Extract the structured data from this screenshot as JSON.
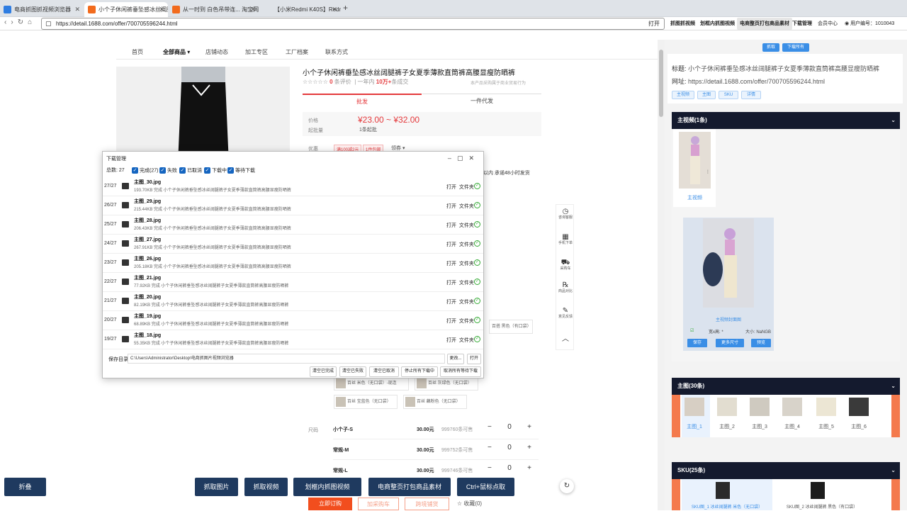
{
  "tabs": [
    {
      "label": "电商抓图抓视频浏览器",
      "color": "#2f7de1"
    },
    {
      "label": "小个子休闲裤垂坠感冰丝阔腿裤子",
      "color": "#f26b1d"
    },
    {
      "label": "从一时到 白色吊带连... 淘宝网",
      "color": "#f26b1d"
    },
    {
      "label": "【小米Redmi K40S】Redmi K40:",
      "color": "#e22"
    }
  ],
  "newtab": "+",
  "address": {
    "url": "https://detail.1688.com/offer/700705596244.html",
    "open": "打开"
  },
  "topbuttons": [
    "抓图抓视频",
    "划框内抓图视频",
    "电商整页打包商品素材",
    "下载管理",
    "会员中心",
    "用户编号：1010043"
  ],
  "nav": [
    "首页",
    "全部商品 ▾",
    "店铺动态",
    "加工专区",
    "工厂档案",
    "联系方式"
  ],
  "product": {
    "title": "小个子休闲裤垂坠感冰丝阔腿裤子女夏季薄款直筒裤高腰显瘦防晒裤",
    "reviews_count": "0",
    "reviews_label": "条评价",
    "sold_prefix": "一年内",
    "sold": "10万+",
    "sold_suffix": "条成交",
    "report": "本产品采购属于商业贸易行为",
    "tab_wholesale": "批发",
    "tab_dropship": "一件代发",
    "price_label": "价格",
    "price": "¥23.00 ~ ¥32.00",
    "minbuy_label": "起批量",
    "minbuy": "1条起批",
    "promo_label": "优惠",
    "promo1": "满100减2元",
    "promo2": "1件包邮",
    "promo_more": "领券 ▾",
    "delivery_note": "以内 承诺48小时发货",
    "size_label": "尺码",
    "swatches": [
      "百搭 黑色（有口袋）",
      "百丝 米色（无口袋）-现连",
      "百丝 灰绿色（无口袋）",
      "百丝 宝蓝色（无口袋）",
      "百丝 藕粉色（无口袋）"
    ],
    "sizes": [
      {
        "name": "小个子-S",
        "price": "30.00元",
        "stock": "999760条可售",
        "qty": "0"
      },
      {
        "name": "常规-M",
        "price": "30.00元",
        "stock": "999752条可售",
        "qty": "0"
      },
      {
        "name": "常规-L",
        "price": "30.00元",
        "stock": "999746条可售",
        "qty": "0"
      }
    ]
  },
  "sidefloat": [
    {
      "icon": "◷",
      "label": "咨询客服"
    },
    {
      "icon": "▦",
      "label": "手机下单"
    },
    {
      "icon": "⛟",
      "label": "采购车"
    },
    {
      "icon": "℞",
      "label": "商品对比"
    },
    {
      "icon": "✎",
      "label": "意见反馈"
    },
    {
      "icon": "︿",
      "label": ""
    }
  ],
  "bottom": [
    "折叠",
    "抓取图片",
    "抓取视频",
    "划框内抓图视频",
    "电商整页打包商品素材",
    "Ctrl+鼠标点取"
  ],
  "buy": {
    "order": "立即订购",
    "cart": "加采购车",
    "cross": "跨境铺货",
    "fav": "☆ 收藏(0)"
  },
  "dialog": {
    "title": "下载管理",
    "total_label": "总数:",
    "total": "27",
    "filters": [
      "完成(27)",
      "失败",
      "已取消",
      "下载中",
      "等待下载"
    ],
    "rows": [
      {
        "idx": "27/27",
        "name": "主图_30.jpg",
        "size": "193.70KB",
        "status": "完成"
      },
      {
        "idx": "26/27",
        "name": "主图_29.jpg",
        "size": "215.44KB",
        "status": "完成"
      },
      {
        "idx": "25/27",
        "name": "主图_28.jpg",
        "size": "206.43KB",
        "status": "完成"
      },
      {
        "idx": "24/27",
        "name": "主图_27.jpg",
        "size": "267.91KB",
        "status": "完成"
      },
      {
        "idx": "23/27",
        "name": "主图_26.jpg",
        "size": "205.18KB",
        "status": "完成"
      },
      {
        "idx": "22/27",
        "name": "主图_21.jpg",
        "size": "77.92KB",
        "status": "完成"
      },
      {
        "idx": "21/27",
        "name": "主图_20.jpg",
        "size": "82.19KB",
        "status": "完成"
      },
      {
        "idx": "20/27",
        "name": "主图_19.jpg",
        "size": "68.89KB",
        "status": "完成"
      },
      {
        "idx": "19/27",
        "name": "主图_18.jpg",
        "size": "55.35KB",
        "status": "完成"
      }
    ],
    "row_desc": "小个子休闲裤垂坠感冰丝阔腿裤子女夏季薄款直筒裤高腰显瘦防晒裤",
    "open": "打开",
    "folder": "文件夹",
    "save_label": "保存目录",
    "save_path": "C:\\Users\\Administrator\\Desktop\\电商抓图片视频浏览器",
    "change": "更改...",
    "open_btn": "打开",
    "actions": [
      "清空已完成",
      "清空已失败",
      "清空已取消",
      "停止所有下载中",
      "取消所有等待下载"
    ]
  },
  "right": {
    "grab": "抓取",
    "download_all": "下载所有",
    "title_label": "标题:",
    "title": "小个子休闲裤垂坠感冰丝阔腿裤子女夏季薄款直筒裤高腰显瘦防晒裤",
    "url_label": "网址:",
    "url": "https://detail.1688.com/offer/700705596244.html",
    "chips": [
      "主视频",
      "主图",
      "SKU",
      "详情"
    ],
    "video_head": "主视频(1条)",
    "video_caption": "主视频",
    "cover_caption": "主视频封面图",
    "cover_size": "宽x高: *",
    "cover_bytes": "大小: NaNGB",
    "cover_buttons": [
      "保存",
      "更多尺寸",
      "预览"
    ],
    "main_head": "主图(30条)",
    "main_items": [
      "主图_1",
      "主图_2",
      "主图_3",
      "主图_4",
      "主图_5",
      "主图_6"
    ],
    "sku_head": "SKU(25条)",
    "sku_items": [
      "SKU图_1 冰丝阔腿裤 米色（无口袋）",
      "SKU图_2 冰丝阔腿裤 黑色（有口袋）"
    ],
    "chev": "⌄"
  }
}
